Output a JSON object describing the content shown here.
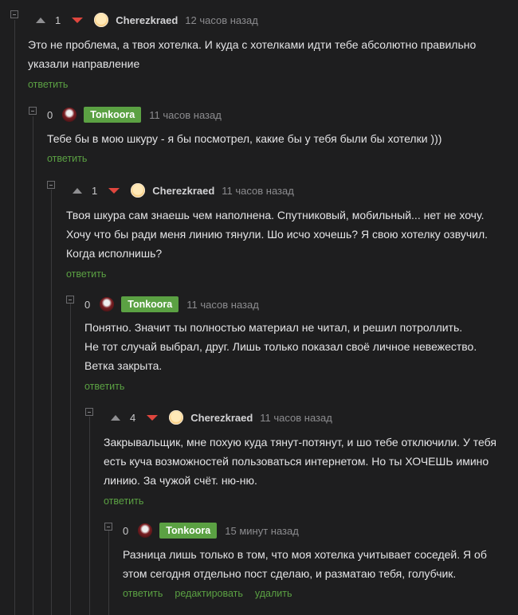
{
  "comments": [
    {
      "rating": "1",
      "author": "Cherezkraed",
      "time": "12 часов назад",
      "text": "Это не проблема, а твоя хотелка. И куда с хотелками идти тебе абсолютно правильно\nуказали направление",
      "actions": [
        "ответить"
      ]
    },
    {
      "rating": "0",
      "author": "Tonkoora",
      "time": "11 часов назад",
      "text": "Тебе бы в мою шкуру - я бы посмотрел, какие бы у тебя были бы хотелки )))",
      "actions": [
        "ответить"
      ]
    },
    {
      "rating": "1",
      "author": "Cherezkraed",
      "time": "11 часов назад",
      "text": "Твоя шкура сам знаешь чем наполнена. Спутниковый, мобильный... нет не хочу.\nХочу что бы ради меня линию тянули. Шо исчо хочешь? Я свою хотелку озвучил.\nКогда исполнишь?",
      "actions": [
        "ответить"
      ]
    },
    {
      "rating": "0",
      "author": "Tonkoora",
      "time": "11 часов назад",
      "text": "Понятно. Значит ты полностью материал не читал, и решил потроллить.\nНе тот случай выбрал, друг. Лишь только показал своё личное невежество.\nВетка закрыта.",
      "actions": [
        "ответить"
      ]
    },
    {
      "rating": "4",
      "author": "Cherezkraed",
      "time": "11 часов назад",
      "text": "Закрывальщик, мне похую куда тянут-потянут, и шо тебе отключили. У тебя\nесть куча возможностей пользоваться интернетом. Но ты ХОЧЕШЬ имино\nлинию. За чужой счёт. ню-ню.",
      "actions": [
        "ответить"
      ]
    },
    {
      "rating": "0",
      "author": "Tonkoora",
      "time": "15 минут назад",
      "text": "Разница лишь только в том, что моя хотелка учитывает соседей. Я об\nэтом сегодня отдельно пост сделаю, и разматаю тебя, голубчик.",
      "actions": [
        "ответить",
        "редактировать",
        "удалить"
      ]
    }
  ],
  "colors": {
    "background": "#1e1e1f",
    "accent_green": "#5ba143",
    "downvote_red": "#e0463e"
  },
  "icons": [
    "collapse-icon",
    "upvote-icon",
    "downvote-icon",
    "avatar"
  ]
}
